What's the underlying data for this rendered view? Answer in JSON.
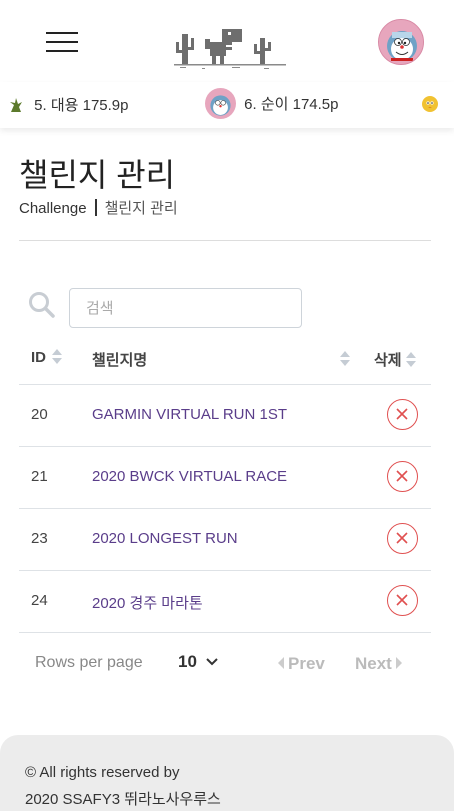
{
  "header": {
    "menu_icon": "hamburger-menu-icon",
    "logo_icon": "dino-cactus-logo",
    "avatar_icon": "doraemon-avatar"
  },
  "ticker": {
    "items": [
      {
        "text": "5. 대용 175.9p",
        "icon": "plant-icon"
      },
      {
        "text": "6. 순이 174.5p",
        "icon": "doraemon-avatar"
      },
      {
        "text": "",
        "icon": "yellow-bird-icon"
      }
    ]
  },
  "page": {
    "title": "챌린지 관리",
    "breadcrumb_root": "Challenge",
    "breadcrumb_current": "챌린지 관리"
  },
  "search": {
    "placeholder": "검색",
    "value": "",
    "icon": "search-icon"
  },
  "table": {
    "columns": {
      "id": "ID",
      "name": "챌린지명",
      "delete": "삭제"
    },
    "rows": [
      {
        "id": "20",
        "name": "GARMIN VIRTUAL RUN 1ST"
      },
      {
        "id": "21",
        "name": "2020 BWCK VIRTUAL RACE"
      },
      {
        "id": "23",
        "name": "2020 LONGEST RUN"
      },
      {
        "id": "24",
        "name": "2020 경주 마라톤"
      }
    ]
  },
  "pagination": {
    "rows_per_page_label": "Rows per page",
    "rows_per_page_value": "10",
    "prev_label": "Prev",
    "next_label": "Next"
  },
  "footer": {
    "line1": "© All rights reserved by",
    "line2": "2020 SSAFY3 뛰라노사우루스"
  },
  "colors": {
    "link": "#5a3d8a",
    "delete": "#e05050",
    "footer_bg": "#ececec",
    "muted": "#bbbbbb"
  }
}
